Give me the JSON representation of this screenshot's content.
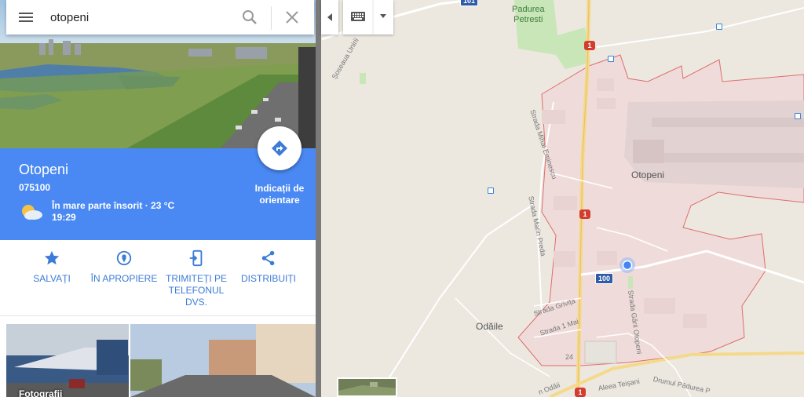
{
  "search": {
    "query": "otopeni",
    "placeholder": ""
  },
  "place": {
    "title": "Otopeni",
    "postal_code": "075100",
    "weather_line1": "În mare parte însorit · 23 °C",
    "weather_line2": "19:29",
    "directions_line1": "Indicații de",
    "directions_line2": "orientare"
  },
  "actions": {
    "save": "SALVAȚI",
    "nearby": "ÎN APROPIERE",
    "send_line1": "TRIMITEȚI PE",
    "send_line2": "TELEFONUL",
    "send_line3": "DVS.",
    "share": "DISTRIBUIȚI"
  },
  "photos": {
    "label": "Fotografii"
  },
  "map": {
    "labels": {
      "city": "Otopeni",
      "village": "Odăile",
      "forest_line1": "Padurea",
      "forest_line2": "Petresti"
    },
    "streets": {
      "soseaua_unirii": "Șoseaua Unirii",
      "mihai_eminescu": "Strada Mihai Eminescu",
      "marin_preda": "Strada Marin Preda",
      "garii_otopeni": "Strada Gării Otopeni",
      "grivita": "Strada Grivița",
      "unu_mai": "Strada 1 Mai",
      "aleea_teisani": "Aleea Teișani",
      "drumul_padurea": "Drumul Pădurea P",
      "odaii": "n Odăii",
      "nr24": "24"
    },
    "shields": {
      "dn1": "1",
      "r100": "100",
      "top": "101"
    }
  },
  "colors": {
    "accent": "#4a89f3",
    "action_blue": "#3c7bd6",
    "boundary": "#d84545"
  }
}
